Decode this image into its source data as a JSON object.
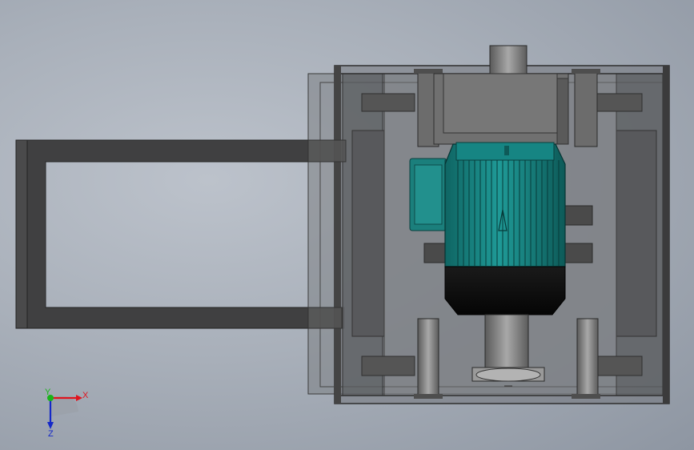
{
  "viewport": {
    "background_top": "#b7bec8",
    "background_bottom": "#8f97a3"
  },
  "triad": {
    "x_label": "X",
    "y_label": "Y",
    "z_label": "Z",
    "x_color": "#e0141e",
    "y_color": "#19b419",
    "z_color": "#1428c8"
  },
  "colors": {
    "frame_dark": "#3f3f40",
    "panel_gray": "#6e6e6e",
    "motor_teal": "#1a8a88",
    "motor_teal_dark": "#0e5f5e",
    "motor_black": "#0c0c0c",
    "shaft_gray": "#8a8a8a"
  }
}
